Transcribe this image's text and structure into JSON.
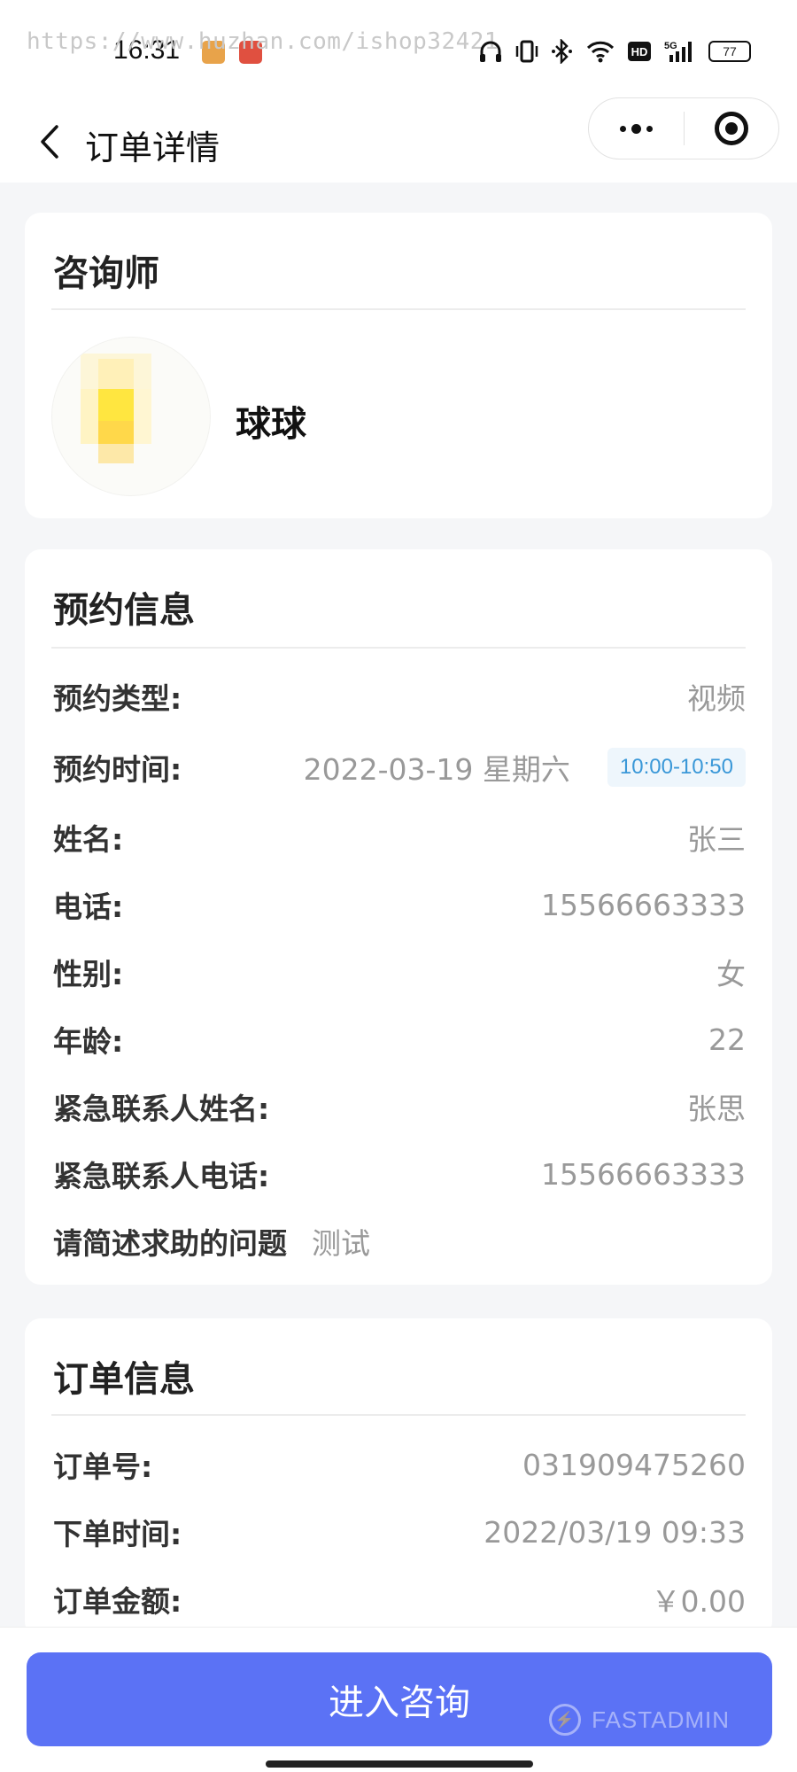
{
  "status_bar": {
    "watermark": "https://www.huzhan.com/ishop32421",
    "time": "16:31",
    "battery": "77",
    "icons": [
      "headphones-icon",
      "vibrate-icon",
      "bluetooth-icon",
      "wifi-icon",
      "hd-icon",
      "signal-5g-icon",
      "battery-icon"
    ]
  },
  "nav": {
    "title": "订单详情",
    "back_icon": "chevron-left-icon",
    "more_icon": "more-dots-icon",
    "close_icon": "target-icon"
  },
  "counselor": {
    "title": "咨询师",
    "name": "球球"
  },
  "appointment": {
    "title": "预约信息",
    "type_label": "预约类型:",
    "type_value": "视频",
    "time_label": "预约时间:",
    "date_value": "2022-03-19 星期六",
    "time_slot": "10:00-10:50",
    "name_label": "姓名:",
    "name_value": "张三",
    "phone_label": "电话:",
    "phone_value": "15566663333",
    "gender_label": "性别:",
    "gender_value": "女",
    "age_label": "年龄:",
    "age_value": "22",
    "emergency_name_label": "紧急联系人姓名:",
    "emergency_name_value": "张思",
    "emergency_phone_label": "紧急联系人电话:",
    "emergency_phone_value": "15566663333",
    "question_label": "请简述求助的问题",
    "question_value": "测试"
  },
  "order": {
    "title": "订单信息",
    "number_label": "订单号:",
    "number_value": "031909475260",
    "time_label": "下单时间:",
    "time_value": "2022/03/19 09:33",
    "amount_label": "订单金额:",
    "amount_value": "￥0.00"
  },
  "cta": {
    "label": "进入咨询",
    "watermark": "FASTADMIN"
  },
  "colors": {
    "primary": "#5b72f5",
    "chip_bg": "#eef6fc",
    "chip_text": "#3a98d8",
    "page_bg": "#f5f6f8"
  }
}
